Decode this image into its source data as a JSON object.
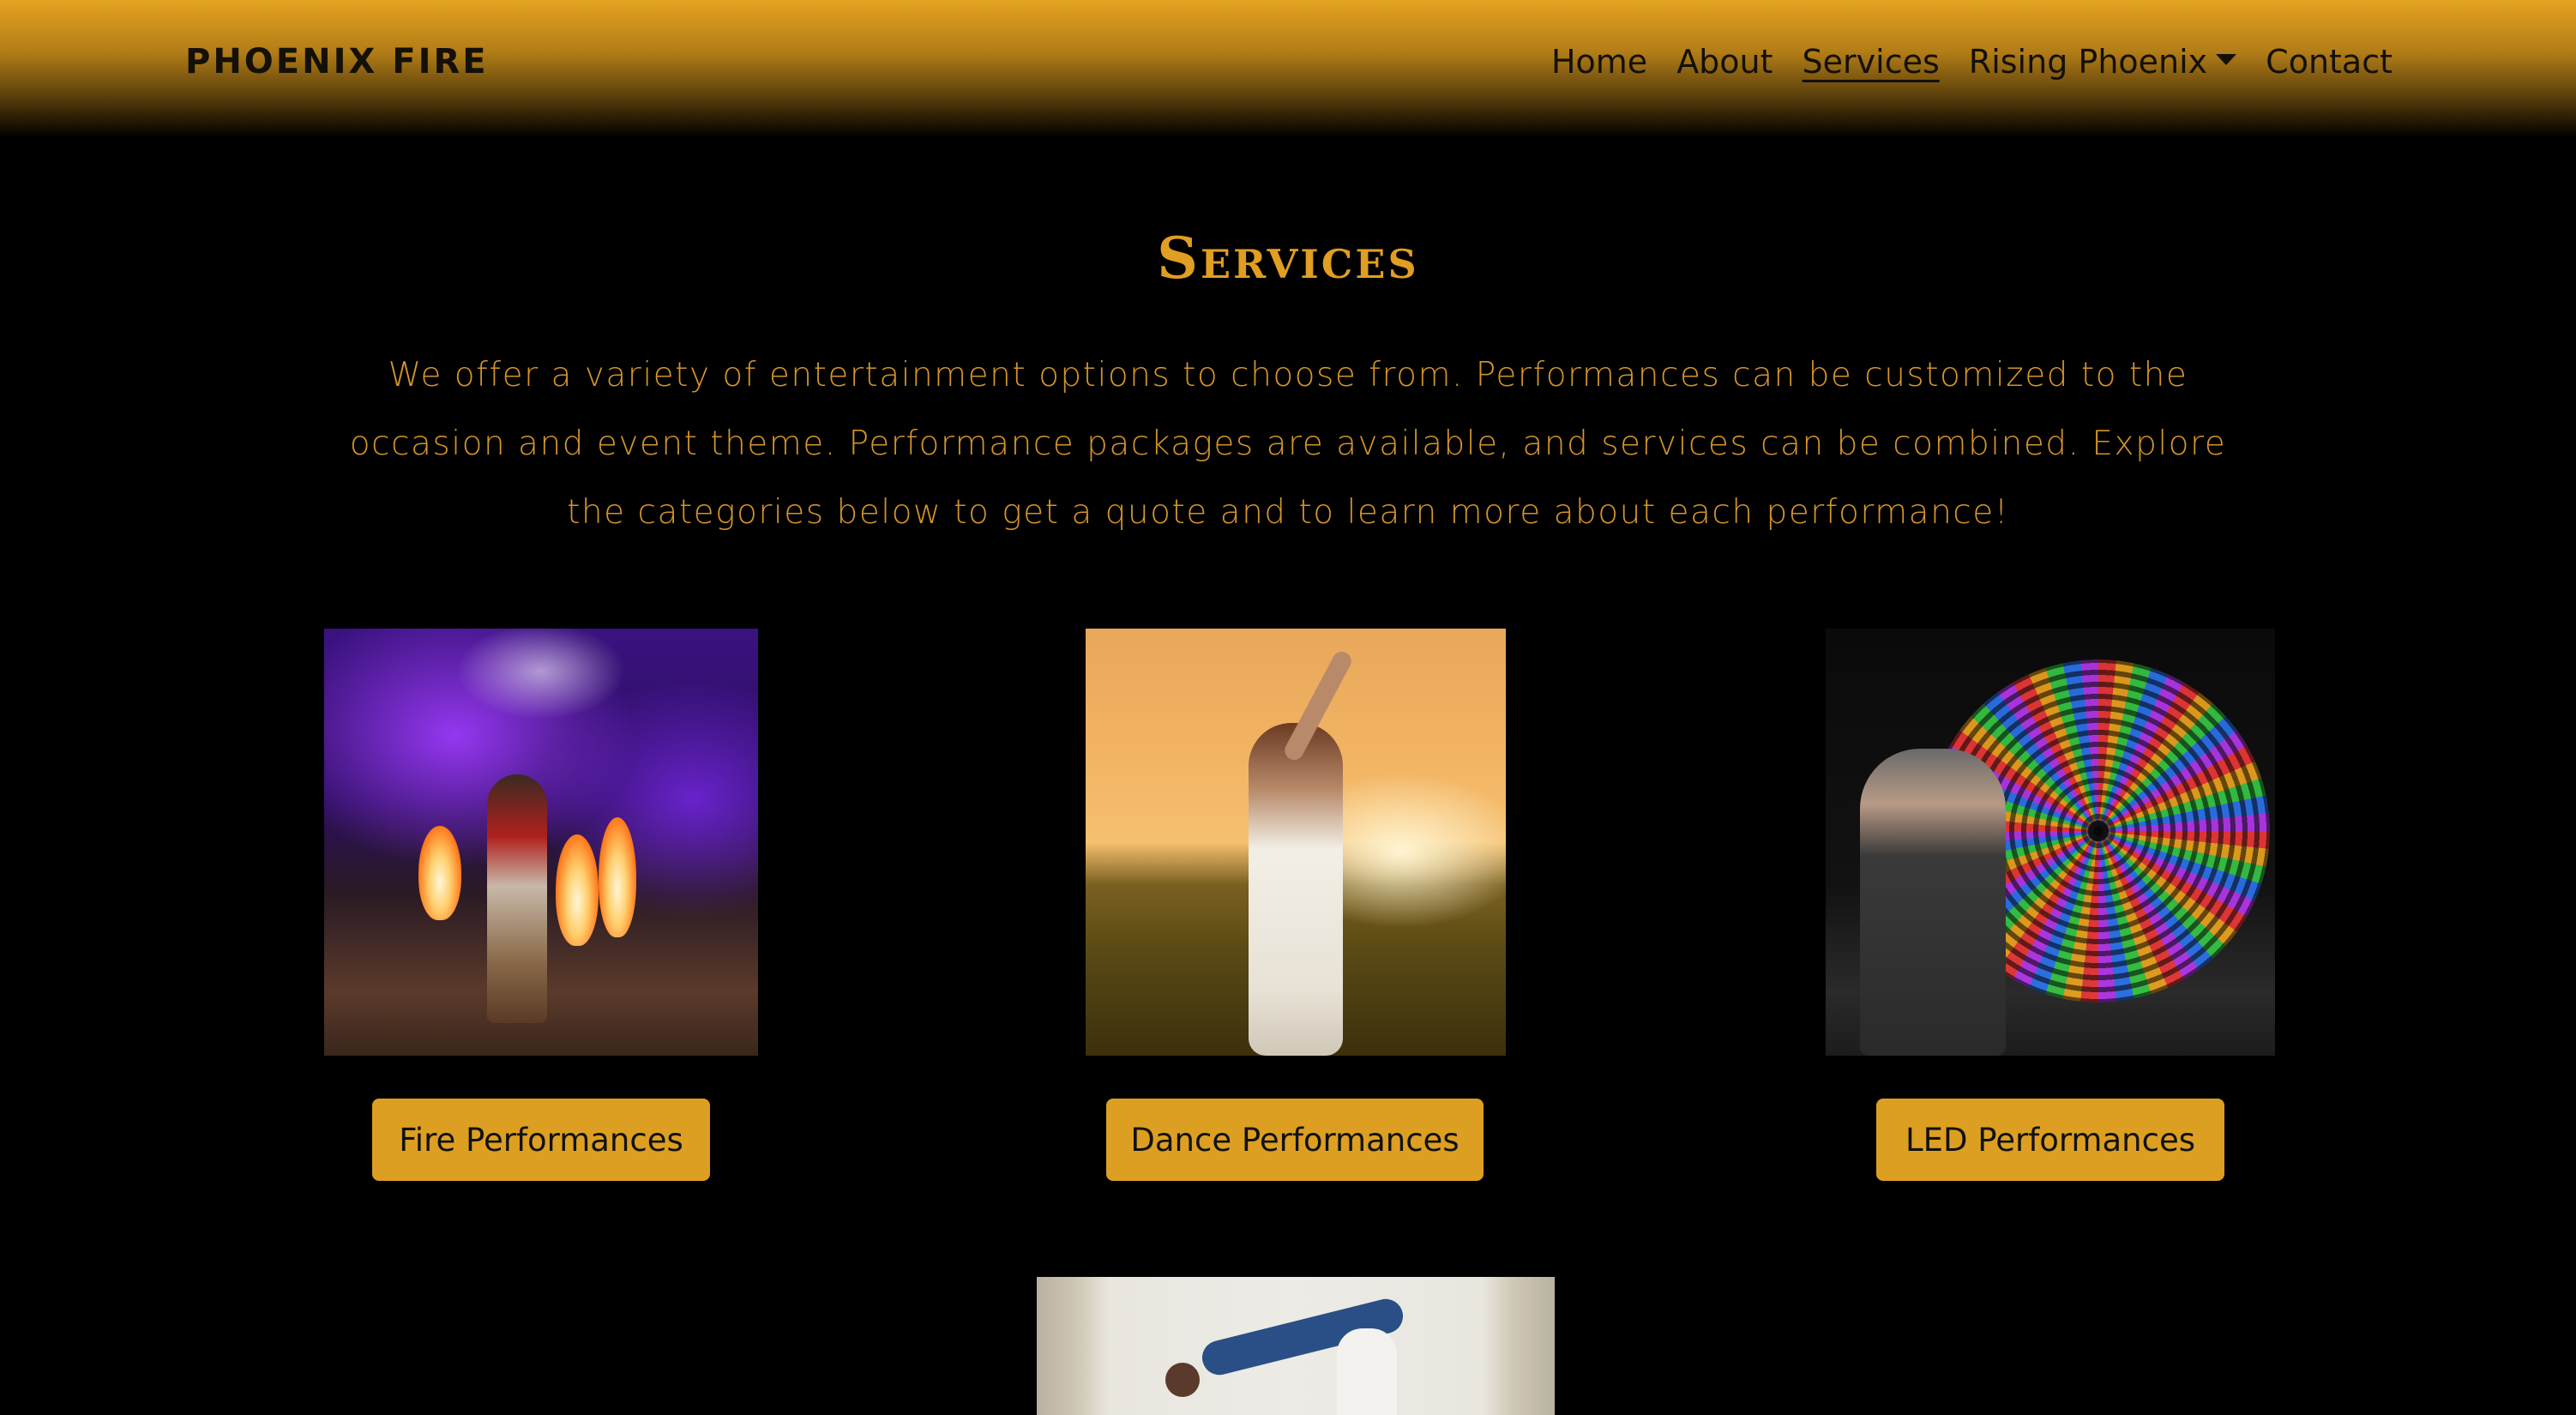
{
  "navbar": {
    "brand": "PHOENIX FIRE",
    "links": [
      {
        "label": "Home"
      },
      {
        "label": "About"
      },
      {
        "label": "Services",
        "active": true
      },
      {
        "label": "Rising Phoenix",
        "dropdown": true
      },
      {
        "label": "Contact"
      }
    ]
  },
  "main": {
    "title": "Services",
    "intro": "We offer a variety of entertainment options to choose from. Performances can be customized to the occasion and event theme. Performance packages are available, and services can be combined. Explore the categories below to get a quote and to learn more about each performance!",
    "services": [
      {
        "button_label": "Fire Performances"
      },
      {
        "button_label": "Dance Performances"
      },
      {
        "button_label": "LED Performances"
      }
    ]
  },
  "colors": {
    "accent": "#dd9f21",
    "background": "#000000",
    "nav_text": "#141008",
    "title": "#e09e22"
  },
  "icons": {
    "dropdown_caret": "caret-down-icon"
  }
}
